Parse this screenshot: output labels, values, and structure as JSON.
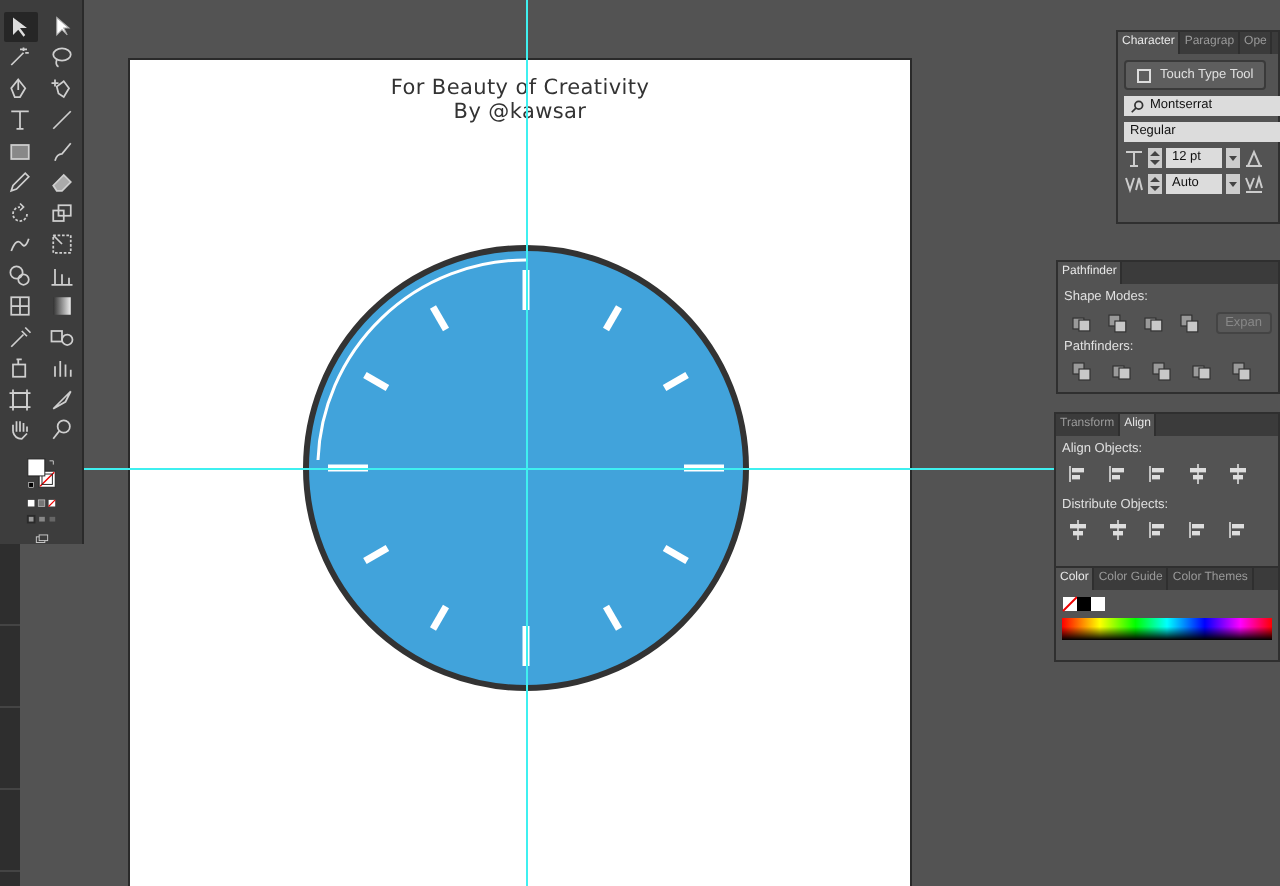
{
  "toolbox": {
    "tools": [
      {
        "selected": true
      },
      {
        "selected": false
      },
      {
        "selected": false
      },
      {
        "selected": false
      },
      {
        "selected": false
      },
      {
        "selected": false
      },
      {
        "selected": false
      },
      {
        "selected": false
      },
      {
        "selected": false
      },
      {
        "selected": false
      },
      {
        "selected": false
      },
      {
        "selected": false
      },
      {
        "selected": false
      },
      {
        "selected": false
      },
      {
        "selected": false
      },
      {
        "selected": false
      },
      {
        "selected": false
      },
      {
        "selected": false
      },
      {
        "selected": false
      },
      {
        "selected": false
      },
      {
        "selected": false
      },
      {
        "selected": false
      },
      {
        "selected": false
      },
      {
        "selected": false
      },
      {
        "selected": false
      },
      {
        "selected": false
      },
      {
        "selected": false
      },
      {
        "selected": false
      }
    ]
  },
  "artboard": {
    "title": "For Beauty of Creativity",
    "subtitle": "By @kawsar"
  },
  "character_panel": {
    "tabs": [
      {
        "label": "Character",
        "selected": true
      },
      {
        "label": "Paragrap",
        "selected": false
      },
      {
        "label": "Ope",
        "selected": false
      }
    ],
    "touch_type_button": "Touch Type Tool",
    "font_family": "Montserrat",
    "font_style": "Regular",
    "font_size": "12 pt",
    "tracking": "Auto"
  },
  "pathfinder_panel": {
    "tabs": [
      {
        "label": "Pathfinder",
        "selected": true
      }
    ],
    "shape_modes_label": "Shape Modes:",
    "expand_button": "Expan",
    "pathfinders_label": "Pathfinders:"
  },
  "align_panel": {
    "tabs": [
      {
        "label": "Transform",
        "selected": false
      },
      {
        "label": "Align",
        "selected": true
      }
    ],
    "align_objects_label": "Align Objects:",
    "distribute_objects_label": "Distribute Objects:"
  },
  "color_panel": {
    "tabs": [
      {
        "label": "Color",
        "selected": true
      },
      {
        "label": "Color Guide",
        "selected": false
      },
      {
        "label": "Color Themes",
        "selected": false
      }
    ]
  }
}
